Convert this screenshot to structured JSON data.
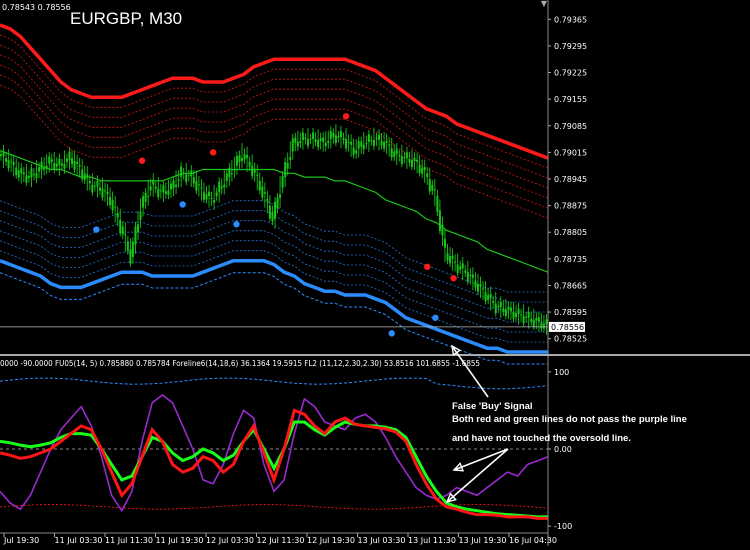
{
  "window": {
    "symbol_title": "EURGBP, M30",
    "price_header": "0.78543 0.78556",
    "scroll_icon": "triangle-down-icon",
    "indicator_header": "0000 -90.0000 FU05(14, 5) 0.785880 0.785784 Foreline6(14,18,6) 36.1364 19.5915 FL2 (11,12,2.30,2.30) 53.8516 101.6855 -1.6855"
  },
  "annotation": {
    "lines": [
      "False 'Buy' Signal",
      "Both red and green lines do not pass the purple line",
      "and have not touched the oversold line."
    ]
  },
  "colors": {
    "background": "#000000",
    "candle": "#16c716",
    "upper_band": "#ff1a1a",
    "lower_band": "#2a8cff",
    "mid_line": "#19c519",
    "indicator_red": "#ff1515",
    "indicator_green": "#19ff19",
    "indicator_purple": "#9a2ad0",
    "white": "#ffffff"
  },
  "chart_data": [
    {
      "type": "line",
      "panel": "price",
      "title": "EURGBP, M30",
      "ylim": [
        0.7849,
        0.794
      ],
      "y_ticks": [
        "0.79365",
        "0.79295",
        "0.79225",
        "0.79155",
        "0.79085",
        "0.79015",
        "0.78945",
        "0.78875",
        "0.78805",
        "0.78735",
        "0.78665",
        "0.78595",
        "0.78525"
      ],
      "y_tick_values": [
        0.79365,
        0.79295,
        0.79225,
        0.79155,
        0.79085,
        0.79015,
        0.78945,
        0.78875,
        0.78805,
        0.78735,
        0.78665,
        0.78595,
        0.78525
      ],
      "current_price": "0.78556",
      "current_price_value": 0.78556,
      "x_ticks": [
        "Jul 19:30",
        "11 Jul 03:30",
        "11 Jul 11:30",
        "11 Jul 19:30",
        "12 Jul 03:30",
        "12 Jul 11:30",
        "12 Jul 19:30",
        "13 Jul 03:30",
        "13 Jul 11:30",
        "13 Jul 19:30",
        "16 Jul 04:30"
      ],
      "x": [
        0,
        10,
        20,
        30,
        40,
        50,
        60,
        70,
        80,
        90,
        100,
        110,
        120,
        130,
        140,
        150,
        160,
        170,
        180,
        190,
        200,
        210,
        220,
        230,
        240,
        250,
        260,
        270,
        280,
        290,
        300,
        310,
        320,
        330,
        340,
        350,
        360,
        370,
        380,
        390,
        400,
        410,
        420,
        430,
        440,
        450,
        460,
        470,
        480,
        490,
        500,
        510,
        520,
        530,
        540
      ],
      "series": [
        {
          "role": "close",
          "values": [
            0.7901,
            0.7899,
            0.7896,
            0.7895,
            0.7897,
            0.7899,
            0.7898,
            0.79,
            0.7897,
            0.7893,
            0.7892,
            0.7889,
            0.7882,
            0.7874,
            0.7887,
            0.7893,
            0.7891,
            0.7892,
            0.7896,
            0.7895,
            0.7891,
            0.7889,
            0.7893,
            0.7897,
            0.7901,
            0.7897,
            0.7891,
            0.7884,
            0.7895,
            0.7904,
            0.7905,
            0.7905,
            0.7904,
            0.7906,
            0.7905,
            0.7902,
            0.7904,
            0.7905,
            0.7904,
            0.7901,
            0.79,
            0.7899,
            0.7896,
            0.789,
            0.7875,
            0.7872,
            0.787,
            0.7867,
            0.7864,
            0.7861,
            0.786,
            0.7859,
            0.7858,
            0.7857,
            0.7856
          ]
        },
        {
          "role": "upper-band",
          "values": [
            0.7935,
            0.7934,
            0.7932,
            0.7929,
            0.7926,
            0.7923,
            0.792,
            0.7918,
            0.7917,
            0.7916,
            0.7916,
            0.7916,
            0.7916,
            0.7917,
            0.7918,
            0.7919,
            0.792,
            0.7921,
            0.7921,
            0.7921,
            0.792,
            0.792,
            0.792,
            0.7921,
            0.7922,
            0.7924,
            0.7925,
            0.7926,
            0.7926,
            0.7926,
            0.7926,
            0.7926,
            0.7926,
            0.7926,
            0.7926,
            0.7925,
            0.7924,
            0.7923,
            0.7921,
            0.7919,
            0.7917,
            0.7915,
            0.7913,
            0.7912,
            0.7911,
            0.7909,
            0.7908,
            0.7907,
            0.7906,
            0.7905,
            0.7904,
            0.7903,
            0.7902,
            0.7901,
            0.79
          ]
        },
        {
          "role": "middle-line",
          "values": [
            0.7902,
            0.7901,
            0.79,
            0.7899,
            0.7898,
            0.7897,
            0.7897,
            0.7896,
            0.7895,
            0.7895,
            0.7894,
            0.7894,
            0.7894,
            0.7894,
            0.7894,
            0.7894,
            0.7894,
            0.7895,
            0.7896,
            0.7896,
            0.7897,
            0.7897,
            0.7897,
            0.7897,
            0.7897,
            0.7897,
            0.7897,
            0.7897,
            0.7896,
            0.7896,
            0.7895,
            0.7895,
            0.7895,
            0.7894,
            0.7894,
            0.7893,
            0.7892,
            0.7891,
            0.7889,
            0.7888,
            0.7887,
            0.7886,
            0.7884,
            0.7883,
            0.7881,
            0.788,
            0.7879,
            0.7878,
            0.7876,
            0.7875,
            0.7874,
            0.7873,
            0.7872,
            0.7871,
            0.787
          ]
        },
        {
          "role": "lower-band",
          "values": [
            0.7873,
            0.7872,
            0.7871,
            0.787,
            0.7869,
            0.7867,
            0.7866,
            0.7866,
            0.7866,
            0.7867,
            0.7868,
            0.7869,
            0.787,
            0.787,
            0.787,
            0.7869,
            0.7869,
            0.7869,
            0.7869,
            0.7869,
            0.787,
            0.7871,
            0.7872,
            0.7873,
            0.7873,
            0.7873,
            0.7873,
            0.7872,
            0.787,
            0.7869,
            0.7867,
            0.7866,
            0.7865,
            0.7865,
            0.7864,
            0.7864,
            0.7864,
            0.7863,
            0.7862,
            0.786,
            0.7858,
            0.7857,
            0.7856,
            0.7855,
            0.7854,
            0.7853,
            0.7852,
            0.7851,
            0.785,
            0.785,
            0.7849,
            0.7849,
            0.7849,
            0.7849,
            0.7849
          ]
        }
      ],
      "signal_dots": [
        {
          "x": 95,
          "value": 0.78812,
          "color": "#2a8cff"
        },
        {
          "x": 140,
          "value": 0.78993,
          "color": "#ff1a1a"
        },
        {
          "x": 180,
          "value": 0.78878,
          "color": "#2a8cff"
        },
        {
          "x": 210,
          "value": 0.79015,
          "color": "#ff1a1a"
        },
        {
          "x": 233,
          "value": 0.78826,
          "color": "#2a8cff"
        },
        {
          "x": 341,
          "value": 0.7911,
          "color": "#ff1a1a"
        },
        {
          "x": 386,
          "value": 0.78539,
          "color": "#2a8cff"
        },
        {
          "x": 421,
          "value": 0.78714,
          "color": "#ff1a1a"
        },
        {
          "x": 429,
          "value": 0.7858,
          "color": "#2a8cff"
        },
        {
          "x": 447,
          "value": 0.78684,
          "color": "#ff1a1a"
        }
      ]
    },
    {
      "type": "line",
      "panel": "indicator",
      "ylim": [
        -105,
        105
      ],
      "y_ticks": [
        "100",
        "0.00",
        "-100"
      ],
      "y_tick_values": [
        100,
        0,
        -100
      ],
      "levels": [
        90,
        0,
        -90
      ],
      "x": [
        0,
        10,
        20,
        30,
        40,
        50,
        60,
        70,
        80,
        90,
        100,
        110,
        120,
        130,
        140,
        150,
        160,
        170,
        180,
        190,
        200,
        210,
        220,
        230,
        240,
        250,
        260,
        270,
        280,
        290,
        300,
        310,
        320,
        330,
        340,
        350,
        360,
        370,
        380,
        390,
        400,
        410,
        420,
        430,
        440,
        450,
        460,
        470,
        480,
        490,
        500,
        510,
        520,
        530,
        540
      ],
      "series": [
        {
          "role": "red",
          "values": [
            -5,
            -8,
            -12,
            -10,
            -5,
            0,
            10,
            20,
            30,
            25,
            0,
            -30,
            -60,
            -45,
            -10,
            25,
            10,
            -20,
            -30,
            -25,
            -10,
            -15,
            -30,
            -20,
            10,
            30,
            -5,
            -40,
            0,
            50,
            45,
            30,
            20,
            35,
            40,
            32,
            30,
            28,
            26,
            22,
            10,
            -20,
            -45,
            -65,
            -75,
            -78,
            -82,
            -85,
            -85,
            -86,
            -88,
            -88,
            -88,
            -90,
            -90
          ]
        },
        {
          "role": "green",
          "values": [
            10,
            8,
            5,
            3,
            5,
            8,
            15,
            20,
            20,
            18,
            0,
            -20,
            -40,
            -35,
            -10,
            15,
            10,
            -5,
            -15,
            -10,
            0,
            -5,
            -15,
            -8,
            10,
            25,
            0,
            -25,
            0,
            35,
            35,
            25,
            18,
            28,
            35,
            32,
            30,
            30,
            28,
            25,
            15,
            -10,
            -35,
            -55,
            -70,
            -75,
            -78,
            -80,
            -82,
            -84,
            -85,
            -86,
            -87,
            -88,
            -88
          ]
        },
        {
          "role": "purple",
          "values": [
            -55,
            -70,
            -78,
            -60,
            -30,
            0,
            25,
            40,
            55,
            30,
            -10,
            -60,
            -80,
            -55,
            10,
            60,
            70,
            60,
            30,
            0,
            -40,
            -45,
            -20,
            20,
            50,
            40,
            -20,
            -55,
            -40,
            20,
            65,
            55,
            35,
            30,
            25,
            40,
            45,
            35,
            15,
            -10,
            -30,
            -50,
            -60,
            -65,
            -60,
            -50,
            -55,
            -60,
            -50,
            -40,
            -30,
            -35,
            -20,
            -15,
            -10
          ]
        }
      ]
    }
  ]
}
